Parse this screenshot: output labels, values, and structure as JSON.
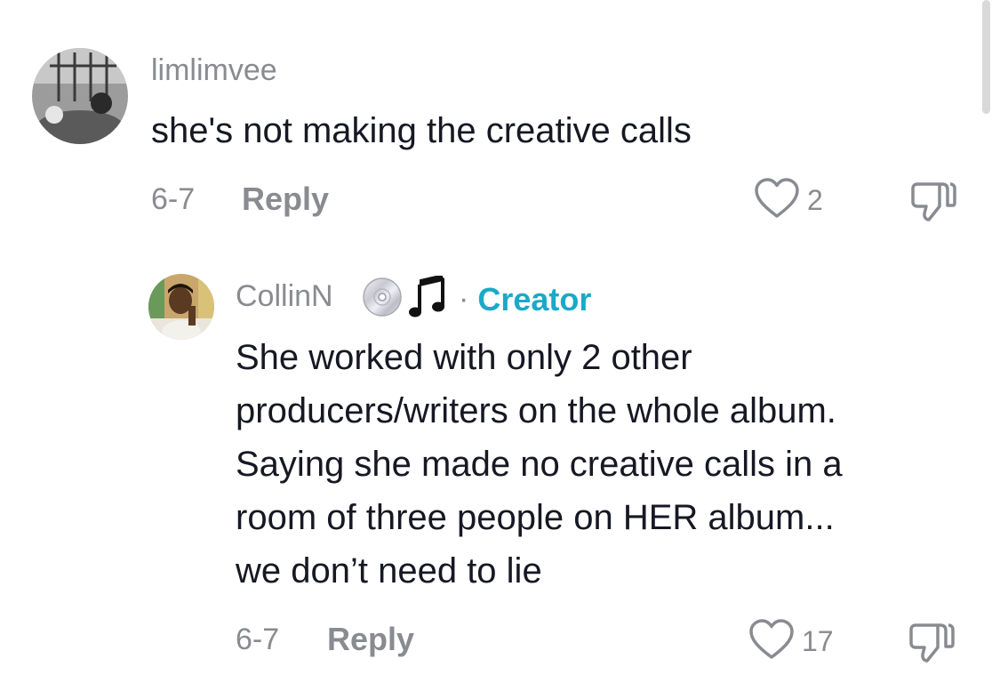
{
  "comments": [
    {
      "username": "limlimvee",
      "lines": [
        "she's not making the creative calls"
      ],
      "date": "6-7",
      "reply_label": "Reply",
      "likes": "2"
    },
    {
      "username": "CollinN",
      "badge_icons": [
        "disc-icon",
        "music-note-icon"
      ],
      "separator": "·",
      "role": "Creator",
      "lines": [
        "She worked with only 2 other",
        "producers/writers on the whole album.",
        "Saying she made no creative calls in a",
        "room of three people on HER album...",
        "we don’t need to lie"
      ],
      "date": "6-7",
      "reply_label": "Reply",
      "likes": "17"
    }
  ],
  "colors": {
    "secondary_text": "#8a8b91",
    "primary_text": "#161823",
    "creator_accent": "#1aa9c8"
  }
}
